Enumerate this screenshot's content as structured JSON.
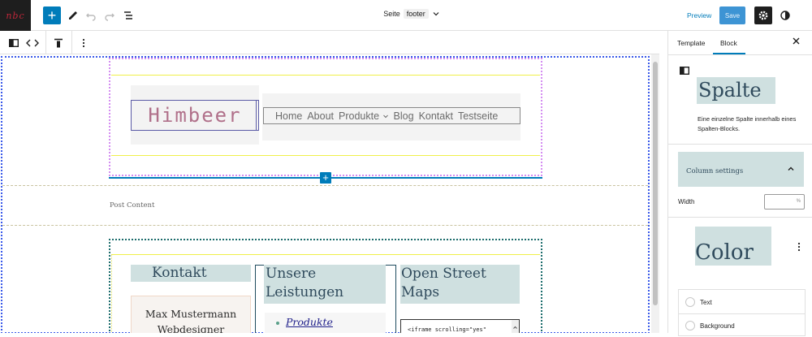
{
  "topbar": {
    "logo_text": "nbc",
    "document": {
      "prefix": "Seite",
      "name": "footer"
    },
    "preview_label": "Preview",
    "save_label": "Save"
  },
  "canvas": {
    "logo_text": "Himbeer",
    "nav_items": [
      "Home",
      "About",
      "Produkte",
      "Blog",
      "Kontakt",
      "Testseite"
    ],
    "post_content_label": "Post Content",
    "footer": {
      "col1_heading": "Kontakt",
      "col1_line1": "Max Mustermann",
      "col1_line2": "Webdesigner",
      "col2_heading_line1": "Unsere",
      "col2_heading_line2": "Leistungen",
      "col2_list_item": "Produkte",
      "col3_heading_line1": "Open Street",
      "col3_heading_line2": "Maps",
      "col3_code": "<iframe scrolling=\"yes\""
    }
  },
  "sidebar": {
    "tabs": [
      "Template",
      "Block"
    ],
    "active_tab": "Block",
    "block_title": "Spalte",
    "block_description": "Eine einzelne Spalte innerhalb eines Spalten-Blocks.",
    "column_settings_title": "Column settings",
    "width_label": "Width",
    "width_unit": "%",
    "color_title": "Color",
    "color_options": [
      "Text",
      "Background"
    ]
  },
  "colors": {
    "accent": "#007cba",
    "save_button": "#3d94d4",
    "heading_bg": "#cfe0e0",
    "heading_text": "#2f4a5c"
  },
  "icons": {
    "topbar": [
      "add-block-icon",
      "edit-tools-icon",
      "undo-icon",
      "redo-icon",
      "document-overview-icon",
      "chevron-down-icon",
      "settings-gear-icon",
      "styles-half-circle-icon"
    ],
    "block_toolbar": [
      "column-block-icon",
      "move-arrows-icon",
      "vertical-align-icon",
      "more-options-icon"
    ]
  }
}
